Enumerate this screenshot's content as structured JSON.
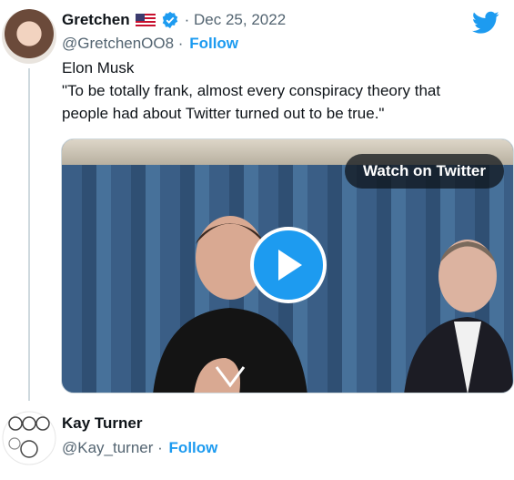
{
  "tweet": {
    "author_name": "Gretchen",
    "flag_icon": "us-flag-icon",
    "verified_icon": "verified-badge-icon",
    "date_line": "· Dec 25, 2022",
    "handle": "@GretchenOO8 ·",
    "follow_label": "Follow",
    "text": "Elon Musk\n\"To be totally frank, almost every conspiracy theory that\npeople had about Twitter turned out to be true.\"",
    "video": {
      "watch_label": "Watch on Twitter"
    }
  },
  "reply": {
    "author_name": "Kay Turner",
    "handle": "@Kay_turner ·",
    "follow_label": "Follow"
  },
  "colors": {
    "accent": "#1d9bf0",
    "text": "#0f1419",
    "muted": "#536471"
  }
}
